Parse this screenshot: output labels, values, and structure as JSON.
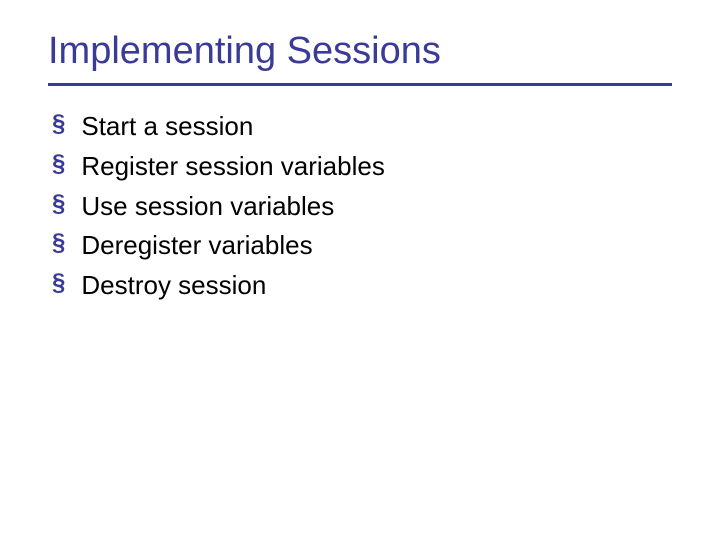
{
  "slide": {
    "title": "Implementing Sessions",
    "bullets": [
      {
        "text": "Start a session"
      },
      {
        "text": "Register session variables"
      },
      {
        "text": "Use session variables"
      },
      {
        "text": "Deregister variables"
      },
      {
        "text": "Destroy session"
      }
    ]
  }
}
